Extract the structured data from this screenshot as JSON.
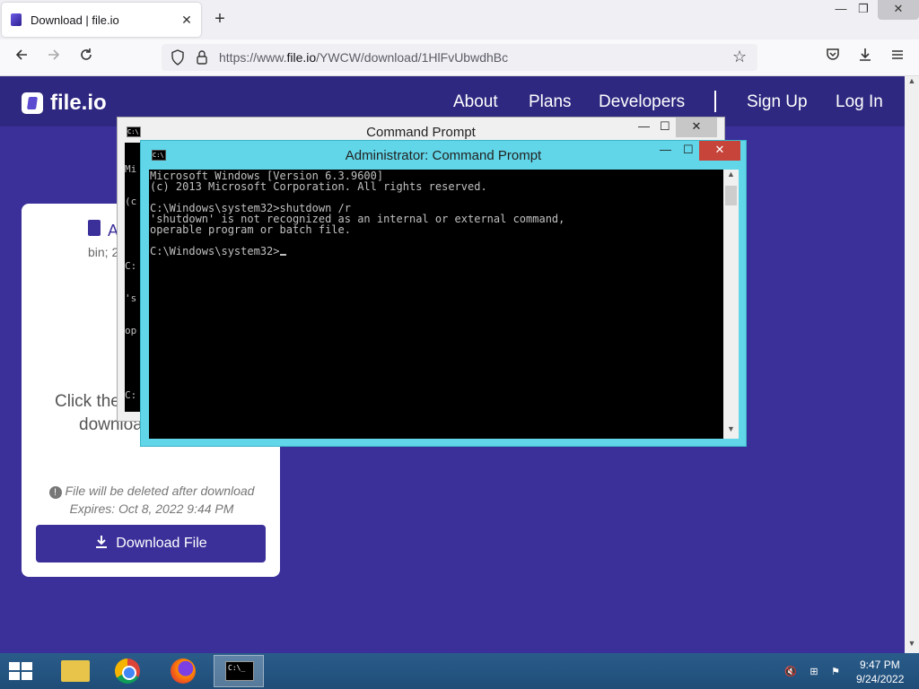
{
  "browser": {
    "tab_title": "Download | file.io",
    "tab_close": "✕",
    "new_tab": "+",
    "url_prefix": "https://www.",
    "url_host": "file.io",
    "url_path": "/YWCW/download/1HlFvUbwdhBc",
    "win_min": "—",
    "win_max": "❐",
    "win_close": "✕"
  },
  "site": {
    "logo_text": "file.io",
    "nav": [
      "About",
      "Plans",
      "Developers",
      "Sign Up",
      "Log In"
    ],
    "card": {
      "file_name_partial": "A",
      "file_meta_partial": "bin; 2",
      "click_text_partial": "Click the",
      "click_text_partial_2": "downloa",
      "note_line1": "File will be deleted after download",
      "note_line2": "Expires: Oct 8, 2022 9:44 PM",
      "download_label": "Download File"
    }
  },
  "cmd_back": {
    "title": "Command Prompt",
    "console_lines": [
      "Mi",
      "(c",
      "",
      "C:",
      "'s",
      "op",
      "",
      "C:"
    ]
  },
  "cmd_front": {
    "title": "Administrator: Command Prompt",
    "console_lines": [
      "Microsoft Windows [Version 6.3.9600]",
      "(c) 2013 Microsoft Corporation. All rights reserved.",
      "",
      "C:\\Windows\\system32>shutdown /r",
      "'shutdown' is not recognized as an internal or external command,",
      "operable program or batch file.",
      "",
      "C:\\Windows\\system32>"
    ],
    "close_color": "#c7443b",
    "frame_color": "#61d6e8"
  },
  "taskbar": {
    "time": "9:47 PM",
    "date": "9/24/2022",
    "cmd_icon_text": "C:\\_"
  },
  "icons": {
    "cmd_small": "C:\\"
  }
}
